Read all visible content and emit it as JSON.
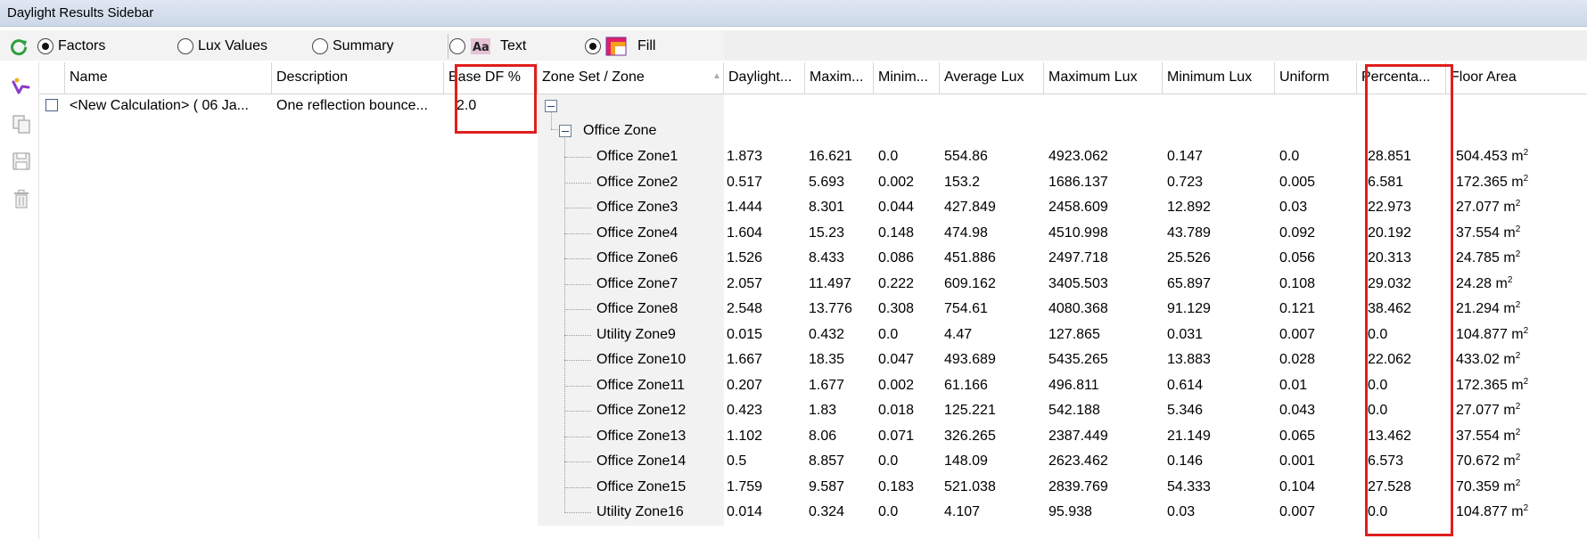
{
  "window": {
    "title": "Daylight Results Sidebar"
  },
  "options": {
    "radios": [
      {
        "label": "Factors",
        "selected": true
      },
      {
        "label": "Lux Values",
        "selected": false
      },
      {
        "label": "Summary",
        "selected": false
      }
    ],
    "display": [
      {
        "label": "Text",
        "selected": false
      },
      {
        "label": "Fill",
        "selected": true
      }
    ]
  },
  "columns": [
    "Name",
    "Description",
    "Base DF %",
    "Zone Set / Zone",
    "Daylight...",
    "Maxim...",
    "Minim...",
    "Average Lux",
    "Maximum Lux",
    "Minimum Lux",
    "Uniform",
    "Percenta...",
    "Floor Area"
  ],
  "calculation": {
    "name": "<New Calculation> ( 06 Ja...",
    "description": "One reflection bounce...",
    "base_df": "2.0"
  },
  "zone_set": {
    "label": "Office Zone"
  },
  "zones": [
    {
      "zone": "Office Zone1",
      "daylight": "1.873",
      "max": "16.621",
      "min": "0.0",
      "avg_lux": "554.86",
      "max_lux": "4923.062",
      "min_lux": "0.147",
      "uniform": "0.0",
      "percent": "28.851",
      "floor_area": "504.453 m",
      "unit_sup": "2"
    },
    {
      "zone": "Office Zone2",
      "daylight": "0.517",
      "max": "5.693",
      "min": "0.002",
      "avg_lux": "153.2",
      "max_lux": "1686.137",
      "min_lux": "0.723",
      "uniform": "0.005",
      "percent": "6.581",
      "floor_area": "172.365 m",
      "unit_sup": "2"
    },
    {
      "zone": "Office Zone3",
      "daylight": "1.444",
      "max": "8.301",
      "min": "0.044",
      "avg_lux": "427.849",
      "max_lux": "2458.609",
      "min_lux": "12.892",
      "uniform": "0.03",
      "percent": "22.973",
      "floor_area": "27.077 m",
      "unit_sup": "2"
    },
    {
      "zone": "Office Zone4",
      "daylight": "1.604",
      "max": "15.23",
      "min": "0.148",
      "avg_lux": "474.98",
      "max_lux": "4510.998",
      "min_lux": "43.789",
      "uniform": "0.092",
      "percent": "20.192",
      "floor_area": "37.554 m",
      "unit_sup": "2"
    },
    {
      "zone": "Office Zone6",
      "daylight": "1.526",
      "max": "8.433",
      "min": "0.086",
      "avg_lux": "451.886",
      "max_lux": "2497.718",
      "min_lux": "25.526",
      "uniform": "0.056",
      "percent": "20.313",
      "floor_area": "24.785 m",
      "unit_sup": "2"
    },
    {
      "zone": "Office Zone7",
      "daylight": "2.057",
      "max": "11.497",
      "min": "0.222",
      "avg_lux": "609.162",
      "max_lux": "3405.503",
      "min_lux": "65.897",
      "uniform": "0.108",
      "percent": "29.032",
      "floor_area": "24.28 m",
      "unit_sup": "2"
    },
    {
      "zone": "Office Zone8",
      "daylight": "2.548",
      "max": "13.776",
      "min": "0.308",
      "avg_lux": "754.61",
      "max_lux": "4080.368",
      "min_lux": "91.129",
      "uniform": "0.121",
      "percent": "38.462",
      "floor_area": "21.294 m",
      "unit_sup": "2"
    },
    {
      "zone": "Utility Zone9",
      "daylight": "0.015",
      "max": "0.432",
      "min": "0.0",
      "avg_lux": "4.47",
      "max_lux": "127.865",
      "min_lux": "0.031",
      "uniform": "0.007",
      "percent": "0.0",
      "floor_area": "104.877 m",
      "unit_sup": "2"
    },
    {
      "zone": "Office Zone10",
      "daylight": "1.667",
      "max": "18.35",
      "min": "0.047",
      "avg_lux": "493.689",
      "max_lux": "5435.265",
      "min_lux": "13.883",
      "uniform": "0.028",
      "percent": "22.062",
      "floor_area": "433.02 m",
      "unit_sup": "2"
    },
    {
      "zone": "Office Zone11",
      "daylight": "0.207",
      "max": "1.677",
      "min": "0.002",
      "avg_lux": "61.166",
      "max_lux": "496.811",
      "min_lux": "0.614",
      "uniform": "0.01",
      "percent": "0.0",
      "floor_area": "172.365 m",
      "unit_sup": "2"
    },
    {
      "zone": "Office Zone12",
      "daylight": "0.423",
      "max": "1.83",
      "min": "0.018",
      "avg_lux": "125.221",
      "max_lux": "542.188",
      "min_lux": "5.346",
      "uniform": "0.043",
      "percent": "0.0",
      "floor_area": "27.077 m",
      "unit_sup": "2"
    },
    {
      "zone": "Office Zone13",
      "daylight": "1.102",
      "max": "8.06",
      "min": "0.071",
      "avg_lux": "326.265",
      "max_lux": "2387.449",
      "min_lux": "21.149",
      "uniform": "0.065",
      "percent": "13.462",
      "floor_area": "37.554 m",
      "unit_sup": "2"
    },
    {
      "zone": "Office Zone14",
      "daylight": "0.5",
      "max": "8.857",
      "min": "0.0",
      "avg_lux": "148.09",
      "max_lux": "2623.462",
      "min_lux": "0.146",
      "uniform": "0.001",
      "percent": "6.573",
      "floor_area": "70.672 m",
      "unit_sup": "2"
    },
    {
      "zone": "Office Zone15",
      "daylight": "1.759",
      "max": "9.587",
      "min": "0.183",
      "avg_lux": "521.038",
      "max_lux": "2839.769",
      "min_lux": "54.333",
      "uniform": "0.104",
      "percent": "27.528",
      "floor_area": "70.359 m",
      "unit_sup": "2"
    },
    {
      "zone": "Utility Zone16",
      "daylight": "0.014",
      "max": "0.324",
      "min": "0.0",
      "avg_lux": "4.107",
      "max_lux": "95.938",
      "min_lux": "0.03",
      "uniform": "0.007",
      "percent": "0.0",
      "floor_area": "104.877 m",
      "unit_sup": "2"
    }
  ],
  "colors": {
    "highlight": "#e01e1e",
    "refresh": "#2e9e3e",
    "tree_bg": "#f2f2f2"
  },
  "icons": [
    "refresh-icon",
    "wand-icon",
    "copy-icon",
    "save-icon",
    "delete-icon",
    "fill-icon"
  ]
}
